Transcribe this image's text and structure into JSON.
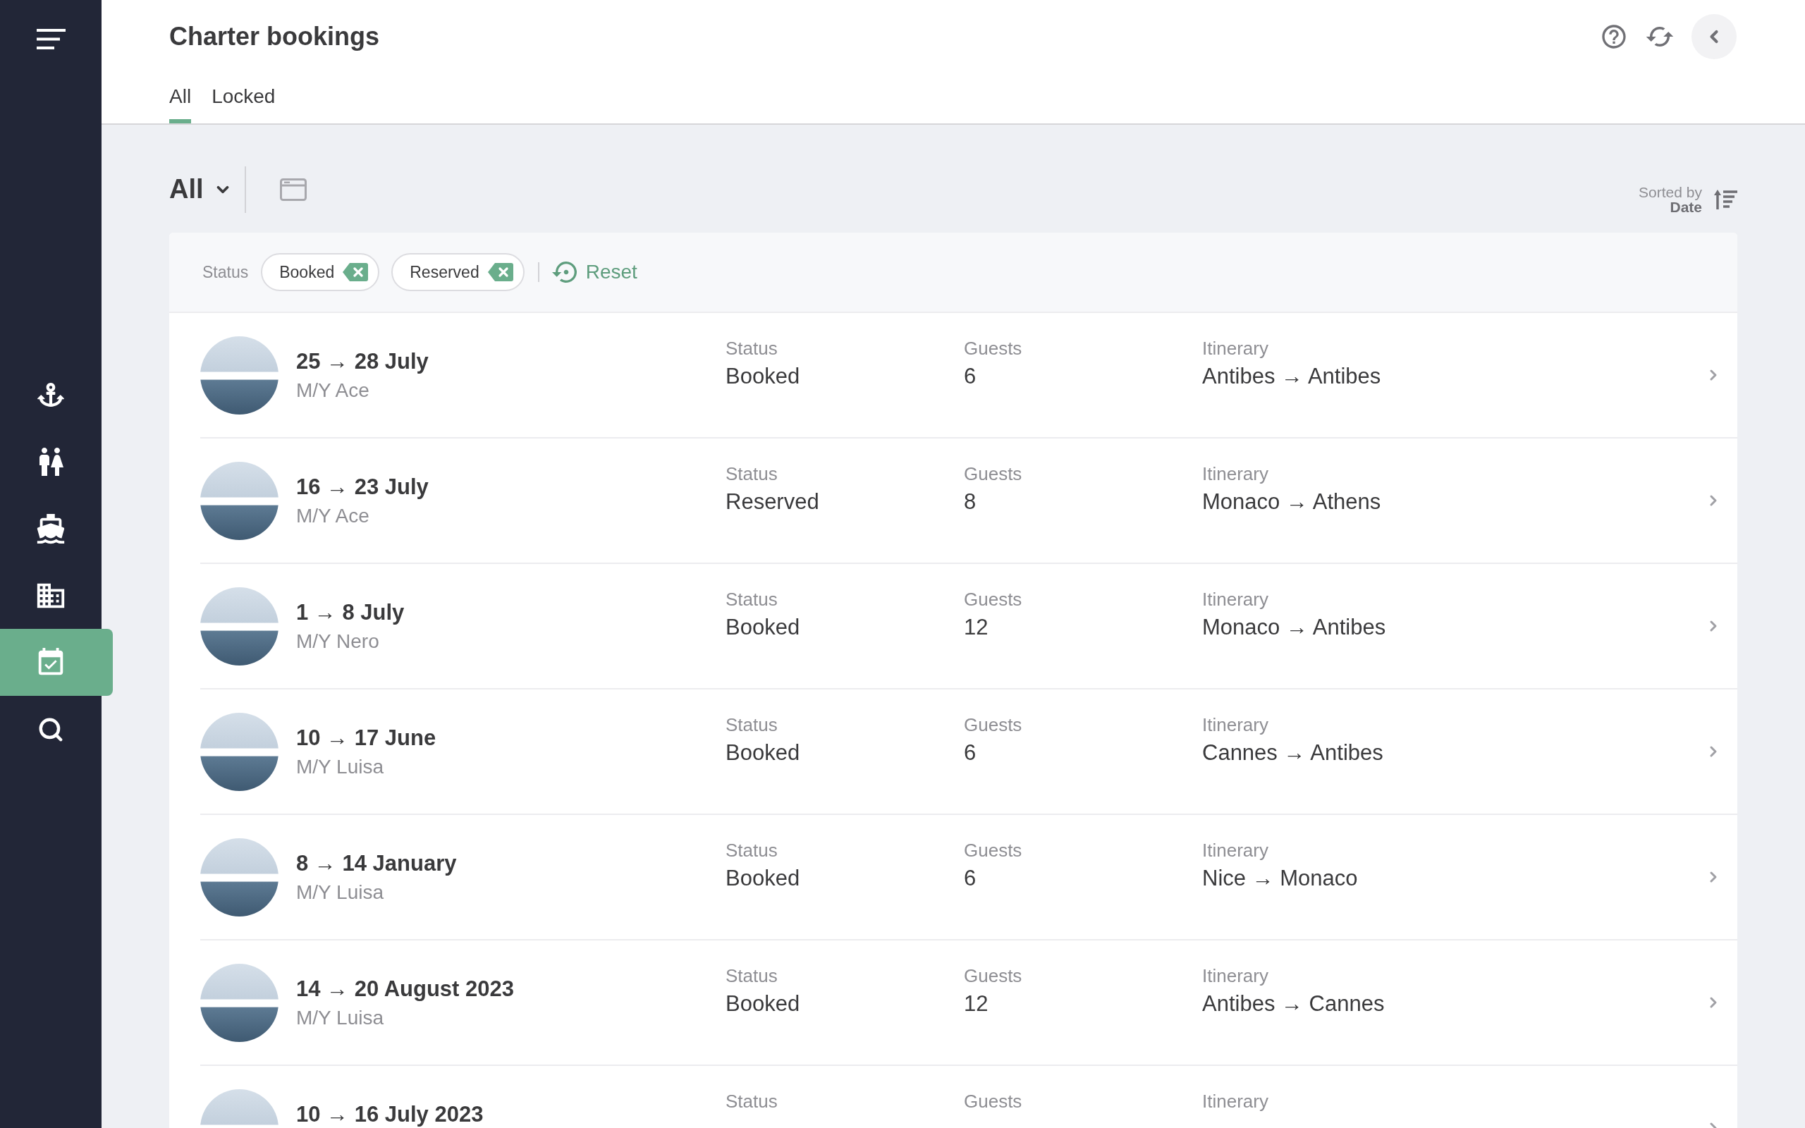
{
  "sidebar": {
    "items": [
      {
        "selected": false
      },
      {
        "selected": false
      },
      {
        "selected": false
      },
      {
        "selected": false
      },
      {
        "selected": true
      },
      {
        "selected": false
      }
    ]
  },
  "header": {
    "title": "Charter bookings",
    "tabs": [
      {
        "label": "All",
        "selected": true
      },
      {
        "label": "Locked",
        "selected": false
      }
    ]
  },
  "toolbar": {
    "view": "All",
    "sort_label": "Sorted by",
    "sort_value": "Date"
  },
  "filters": {
    "label": "Status",
    "chips": [
      "Booked",
      "Reserved"
    ],
    "reset": "Reset"
  },
  "bookings": [
    {
      "dates": "25 → 28 July",
      "yacht": "M/Y Ace",
      "fields": [
        {
          "label": "Status",
          "value": "Booked"
        },
        {
          "label": "Guests",
          "value": "6"
        },
        {
          "label": "Itinerary",
          "value": "Antibes → Antibes"
        }
      ]
    },
    {
      "dates": "16 → 23 July",
      "yacht": "M/Y Ace",
      "fields": [
        {
          "label": "Status",
          "value": "Reserved"
        },
        {
          "label": "Guests",
          "value": "8"
        },
        {
          "label": "Itinerary",
          "value": "Monaco → Athens"
        }
      ]
    },
    {
      "dates": "1 → 8 July",
      "yacht": "M/Y Nero",
      "fields": [
        {
          "label": "Status",
          "value": "Booked"
        },
        {
          "label": "Guests",
          "value": "12"
        },
        {
          "label": "Itinerary",
          "value": "Monaco → Antibes"
        }
      ]
    },
    {
      "dates": "10 → 17 June",
      "yacht": "M/Y Luisa",
      "fields": [
        {
          "label": "Status",
          "value": "Booked"
        },
        {
          "label": "Guests",
          "value": "6"
        },
        {
          "label": "Itinerary",
          "value": "Cannes → Antibes"
        }
      ]
    },
    {
      "dates": "8 → 14 January",
      "yacht": "M/Y Luisa",
      "fields": [
        {
          "label": "Status",
          "value": "Booked"
        },
        {
          "label": "Guests",
          "value": "6"
        },
        {
          "label": "Itinerary",
          "value": "Nice → Monaco"
        }
      ]
    },
    {
      "dates": "14 → 20 August 2023",
      "yacht": "M/Y Luisa",
      "fields": [
        {
          "label": "Status",
          "value": "Booked"
        },
        {
          "label": "Guests",
          "value": "12"
        },
        {
          "label": "Itinerary",
          "value": "Antibes → Cannes"
        }
      ]
    },
    {
      "dates": "10 → 16 July 2023",
      "fields": [
        {
          "label": "Status"
        },
        {
          "label": "Guests"
        },
        {
          "label": "Itinerary"
        }
      ]
    }
  ]
}
